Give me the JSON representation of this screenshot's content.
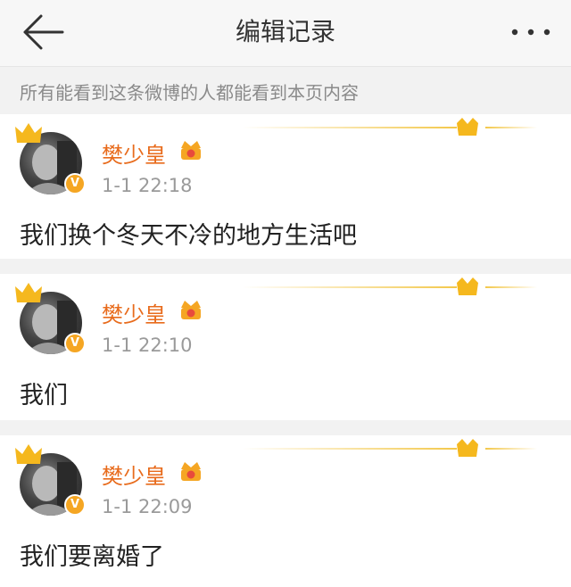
{
  "header": {
    "title": "编辑记录"
  },
  "notice": {
    "text": "所有能看到这条微博的人都能看到本页内容"
  },
  "entries": [
    {
      "user": "樊少皇",
      "time": "1-1 22:18",
      "text": "我们换个冬天不冷的地方生活吧"
    },
    {
      "user": "樊少皇",
      "time": "1-1 22:10",
      "text": "我们"
    },
    {
      "user": "樊少皇",
      "time": "1-1 22:09",
      "text": "我们要离婚了"
    }
  ],
  "icons": {
    "back": "back-arrow-icon",
    "more": "more-dots-icon",
    "crown": "crown-icon",
    "verified": "verified-v-badge-icon",
    "vip": "vip-crown-badge-icon"
  },
  "colors": {
    "username": "#e86b1c",
    "gold": "#f5a623",
    "time": "#9a9a9a"
  }
}
